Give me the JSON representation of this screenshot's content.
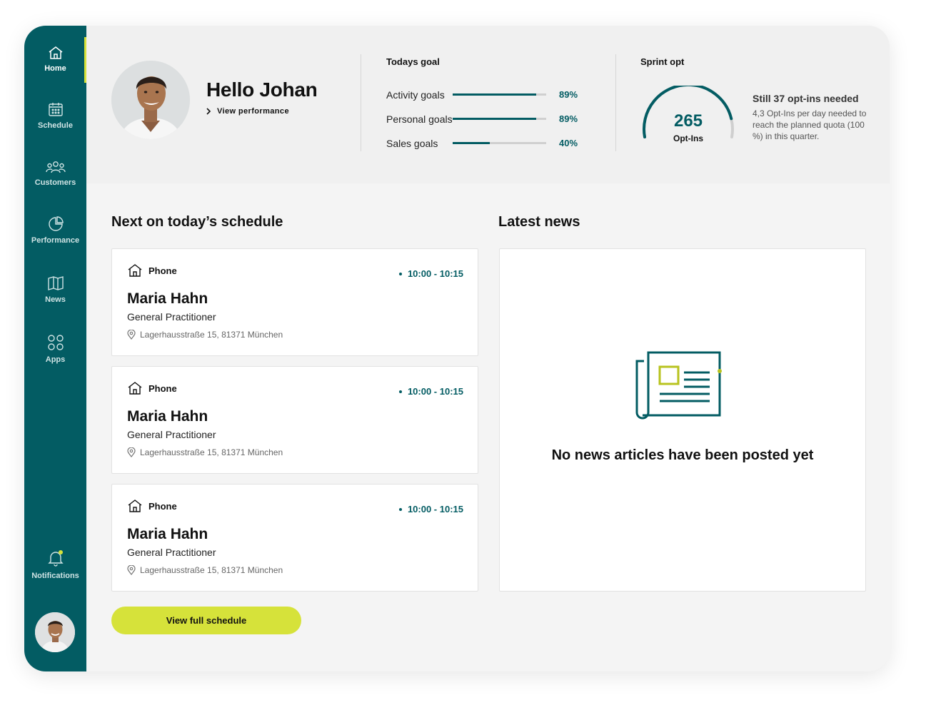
{
  "sidebar": {
    "items": [
      {
        "label": "Home",
        "icon": "home-icon",
        "active": true
      },
      {
        "label": "Schedule",
        "icon": "calendar-icon"
      },
      {
        "label": "Customers",
        "icon": "users-icon"
      },
      {
        "label": "Performance",
        "icon": "pie-chart-icon"
      },
      {
        "label": "News",
        "icon": "book-icon"
      },
      {
        "label": "Apps",
        "icon": "apps-grid-icon"
      }
    ],
    "notifications_label": "Notifications"
  },
  "header": {
    "greeting": "Hello Johan",
    "view_performance": "View performance",
    "todays_goal": {
      "title": "Todays goal",
      "goals": [
        {
          "label": "Activity goals",
          "percent": 89,
          "display": "89%"
        },
        {
          "label": "Personal goals",
          "percent": 89,
          "display": "89%"
        },
        {
          "label": "Sales goals",
          "percent": 40,
          "display": "40%"
        }
      ]
    },
    "sprint": {
      "title": "Sprint opt",
      "value": "265",
      "unit": "Opt-Ins",
      "progress": 0.88,
      "headline": "Still 37 opt-ins needed",
      "description": "4,3 Opt-Ins per day needed to reach the planned quota (100 %) in this quarter."
    }
  },
  "schedule": {
    "title": "Next on today’s schedule",
    "items": [
      {
        "type": "Phone",
        "time": "10:00 - 10:15",
        "name": "Maria Hahn",
        "role": "General Practitioner",
        "address": "Lagerhausstraße 15, 81371 München"
      },
      {
        "type": "Phone",
        "time": "10:00 - 10:15",
        "name": "Maria Hahn",
        "role": "General Practitioner",
        "address": "Lagerhausstraße 15, 81371 München"
      },
      {
        "type": "Phone",
        "time": "10:00 - 10:15",
        "name": "Maria Hahn",
        "role": "General Practitioner",
        "address": "Lagerhausstraße 15, 81371 München"
      }
    ],
    "button_label": "View full schedule"
  },
  "news": {
    "title": "Latest news",
    "empty_message": "No news articles have been posted yet"
  },
  "colors": {
    "primary": "#035c63",
    "accent": "#d6e23a",
    "background": "#f4f4f4"
  }
}
